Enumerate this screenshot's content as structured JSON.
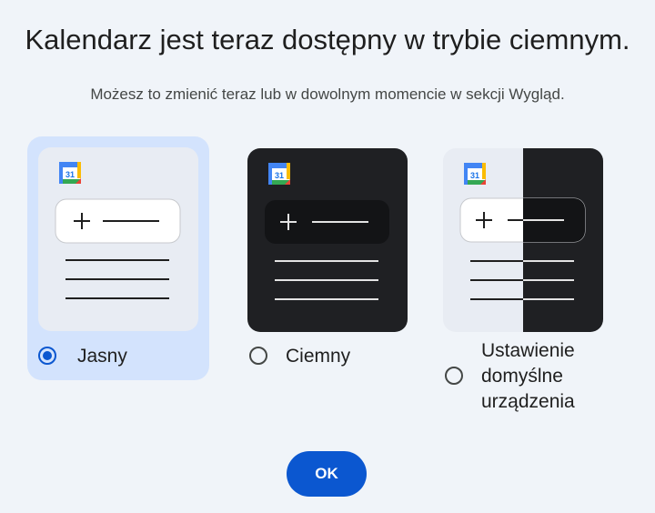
{
  "dialog": {
    "title": "Kalendarz jest teraz dostępny w trybie ciemnym.",
    "subtitle": "Możesz to zmienić teraz lub w dowolnym momencie w sekcji Wygląd.",
    "ok_label": "OK"
  },
  "options": [
    {
      "label": "Jasny",
      "selected": true,
      "preview": "light"
    },
    {
      "label": "Ciemny",
      "selected": false,
      "preview": "dark"
    },
    {
      "label_lines": [
        "Ustawienie",
        "domyślne",
        "urządzenia"
      ],
      "selected": false,
      "preview": "system"
    }
  ],
  "preview": {
    "calendar_icon_text": "31",
    "plus_symbol": "+"
  },
  "colors": {
    "background": "#f0f4f9",
    "selected_card": "#d3e3fd",
    "accent": "#0b57d0",
    "light_preview": "#e8ecf3",
    "dark_preview": "#1f2023"
  }
}
